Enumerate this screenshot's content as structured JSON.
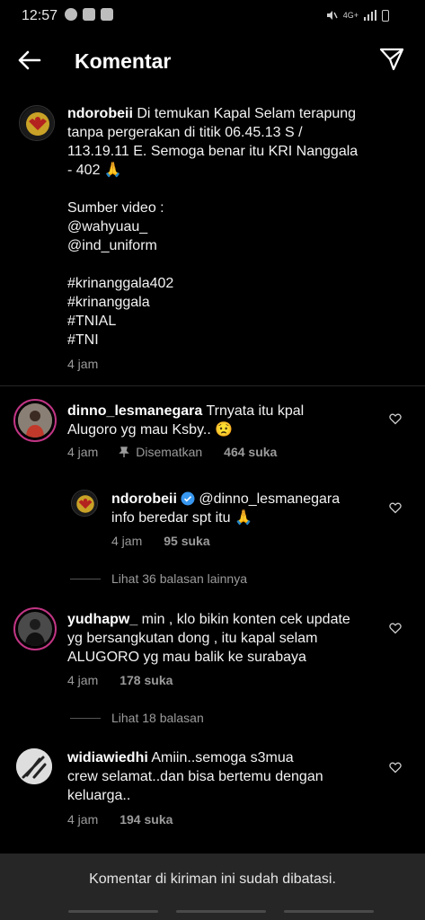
{
  "status_bar": {
    "time": "12:57",
    "network": "4G+",
    "icons": [
      "whatsapp-icon",
      "facebook-icon",
      "gallery-icon",
      "mute-icon",
      "signal-icon",
      "battery-icon"
    ]
  },
  "header": {
    "title": "Komentar",
    "back_icon": "arrow-left-icon",
    "send_icon": "paper-plane-icon"
  },
  "caption": {
    "username": "ndorobeii",
    "text": " Di temukan Kapal Selam terapung\ntanpa pergerakan di titik 06.45.13 S /\n113.19.11 E. Semoga benar itu KRI Nanggala\n- 402 🙏\n\nSumber video :\n@wahyuau_\n@ind_uniform\n\n#krinanggala402\n#krinanggala\n#TNIAL\n#TNI",
    "time": "4 jam"
  },
  "comments": [
    {
      "username": "dinno_lesmanegara",
      "text": " Trnyata itu kpal\nAlugoro yg mau Ksby.. 😟",
      "time": "4 jam",
      "pinned_label": "Disematkan",
      "likes": "464 suka",
      "reply": {
        "username": "ndorobeii",
        "text": " @dinno_lesmanegara\ninfo beredar spt itu 🙏",
        "time": "4 jam",
        "likes": "95 suka"
      },
      "view_replies": "Lihat 36 balasan lainnya"
    },
    {
      "username": "yudhapw_",
      "text": " min , klo bikin konten cek update\nyg bersangkutan dong , itu kapal selam\nALUGORO yg mau balik ke surabaya",
      "time": "4 jam",
      "likes": "178 suka",
      "view_replies": "Lihat 18 balasan"
    },
    {
      "username": "widiawiedhi",
      "text": " Amiin..semoga s3mua\ncrew selamat..dan bisa bertemu dengan\nkeluarga..",
      "time": "4 jam",
      "likes": "194 suka"
    }
  ],
  "footer": {
    "notice": "Komentar di kiriman ini sudah dibatasi."
  },
  "colors": {
    "background": "#000000",
    "secondary_text": "#9b9b9b",
    "verified_blue": "#3897f0",
    "story_ring": "#c13584",
    "bottom_bar": "#262626"
  }
}
